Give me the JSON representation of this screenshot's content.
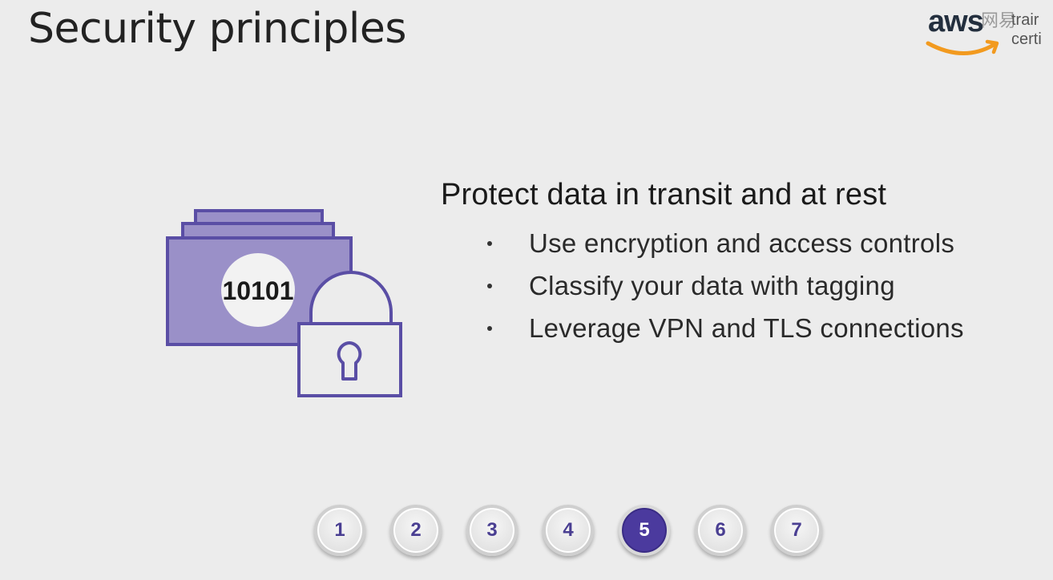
{
  "slide": {
    "title": "Security principles"
  },
  "logo": {
    "brand": "aws",
    "watermark": "网易",
    "line1": "trair",
    "line2": "certi"
  },
  "illustration": {
    "binary_label": "10101",
    "icon": "encrypted-data-lock-icon",
    "colors": {
      "outline": "#5a4ea5",
      "fill": "#9a90c8",
      "circle": "#f2f2f2"
    }
  },
  "main": {
    "heading": "Protect data in transit and at rest",
    "bullets": [
      "Use encryption and access controls",
      "Classify your data with tagging",
      "Leverage VPN and TLS connections"
    ]
  },
  "pager": {
    "pages": [
      "1",
      "2",
      "3",
      "4",
      "5",
      "6",
      "7"
    ],
    "active": "5",
    "accent": "#4b3a9e"
  }
}
